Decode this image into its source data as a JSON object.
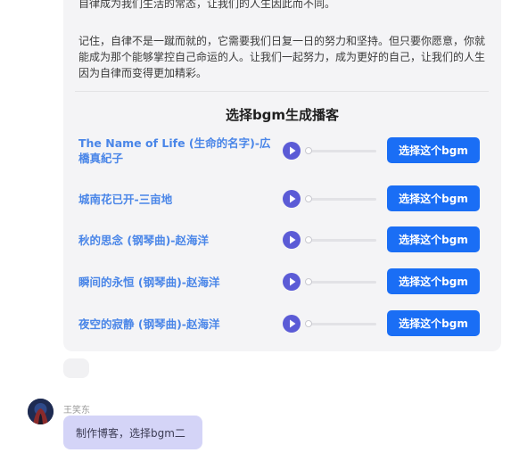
{
  "card": {
    "paragraph1": "自律成为我们生活的常态，让我们的人生因此而不同。",
    "paragraph2": "记住，自律不是一蹴而就的，它需要我们日复一日的努力和坚持。但只要你愿意，你就能成为那个能够掌控自己命运的人。让我们一起努力，成为更好的自己，让我们的人生因为自律而变得更加精彩。",
    "section_title": "选择bgm生成播客",
    "tracks": [
      {
        "title": "The Name of Life (生命的名字)-広橋真紀子",
        "button": "选择这个bgm"
      },
      {
        "title": "城南花已开-三亩地",
        "button": "选择这个bgm"
      },
      {
        "title": "秋的思念 (钢琴曲)-赵海洋",
        "button": "选择这个bgm"
      },
      {
        "title": "瞬间的永恒 (钢琴曲)-赵海洋",
        "button": "选择这个bgm"
      },
      {
        "title": "夜空的寂静 (钢琴曲)-赵海洋",
        "button": "选择这个bgm"
      }
    ]
  },
  "chat": {
    "username": "王笑东",
    "message": "制作博客，选择bgm二"
  },
  "colors": {
    "accent": "#1a6ef5",
    "play": "#5b5bd6",
    "track_title": "#4a86e8",
    "bubble": "#d4d4f7"
  },
  "icons": {
    "play": "play-icon"
  }
}
